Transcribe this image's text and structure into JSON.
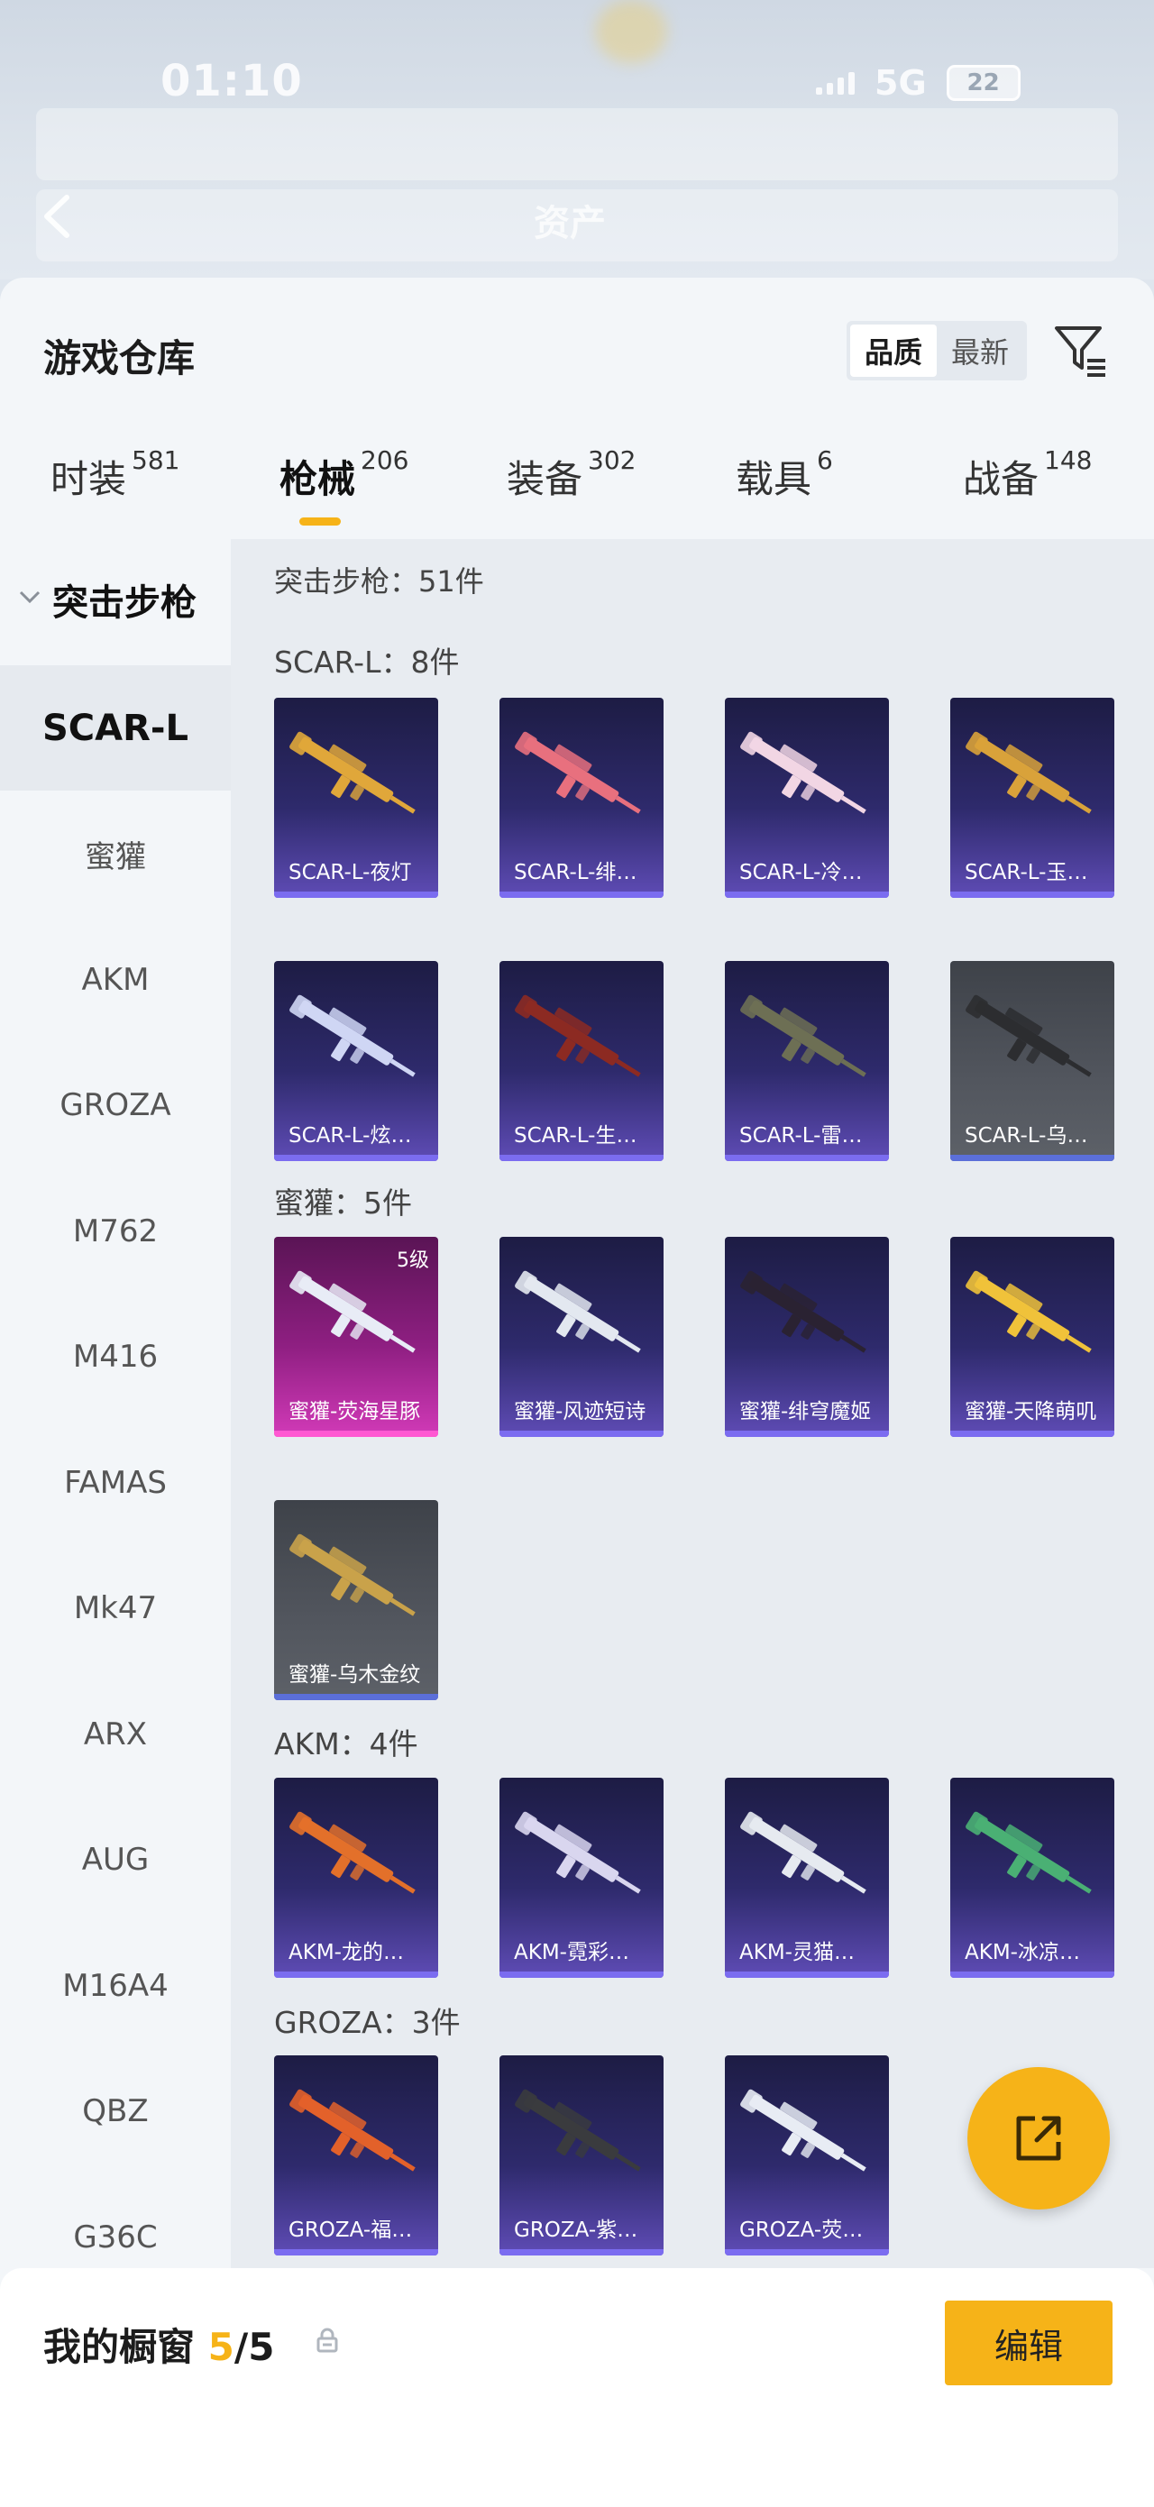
{
  "status": {
    "time": "01:10",
    "network": "5G",
    "battery": "22"
  },
  "header": {
    "title": "资产"
  },
  "panel": {
    "title": "游戏仓库",
    "sort_options": [
      "品质",
      "最新"
    ],
    "sort_selected": "品质"
  },
  "tabs": [
    {
      "label": "时装",
      "count": "581",
      "active": false
    },
    {
      "label": "枪械",
      "count": "206",
      "active": true
    },
    {
      "label": "装备",
      "count": "302",
      "active": false
    },
    {
      "label": "载具",
      "count": "6",
      "active": false
    },
    {
      "label": "战备",
      "count": "148",
      "active": false
    }
  ],
  "sidebar": {
    "category": "突击步枪",
    "items": [
      "SCAR-L",
      "蜜獾",
      "AKM",
      "GROZA",
      "M762",
      "M416",
      "FAMAS",
      "Mk47",
      "ARX",
      "AUG",
      "M16A4",
      "QBZ",
      "G36C"
    ],
    "selected": "SCAR-L"
  },
  "content": {
    "header": "突击步枪：51件",
    "groups": [
      {
        "title": "SCAR-L：8件",
        "items": [
          {
            "name": "SCAR-L-夜灯",
            "style": "purple",
            "gun": "#e0a73a"
          },
          {
            "name": "SCAR-L-绯…",
            "style": "purple",
            "gun": "#e8707e"
          },
          {
            "name": "SCAR-L-冷…",
            "style": "purple",
            "gun": "#f2d6e4"
          },
          {
            "name": "SCAR-L-玉…",
            "style": "purple",
            "gun": "#d9a23a"
          },
          {
            "name": "SCAR-L-炫…",
            "style": "purple",
            "gun": "#cfd6f4"
          },
          {
            "name": "SCAR-L-生…",
            "style": "purple",
            "gun": "#8c2a22"
          },
          {
            "name": "SCAR-L-雷…",
            "style": "purple",
            "gun": "#6d6f54"
          },
          {
            "name": "SCAR-L-乌…",
            "style": "grey",
            "gun": "#2c2d30"
          }
        ]
      },
      {
        "title": "蜜獾：5件",
        "items": [
          {
            "name": "蜜獾-荧海星豚",
            "style": "pink",
            "gun": "#e8ecf6",
            "level": "5级"
          },
          {
            "name": "蜜獾-风迹短诗",
            "style": "purple",
            "gun": "#e3e8f0"
          },
          {
            "name": "蜜獾-绯穹魔姬",
            "style": "purple",
            "gun": "#2a2232"
          },
          {
            "name": "蜜獾-天降萌叽",
            "style": "purple",
            "gun": "#f0c23a"
          },
          {
            "name": "蜜獾-乌木金纹",
            "style": "grey",
            "gun": "#c9a24a"
          }
        ]
      },
      {
        "title": "AKM：4件",
        "items": [
          {
            "name": "AKM-龙的…",
            "style": "purple",
            "gun": "#e3702a"
          },
          {
            "name": "AKM-霓彩…",
            "style": "purple",
            "gun": "#d9d6ef"
          },
          {
            "name": "AKM-灵猫…",
            "style": "purple",
            "gun": "#e6eaf0"
          },
          {
            "name": "AKM-冰凉…",
            "style": "purple",
            "gun": "#4ab074"
          }
        ]
      },
      {
        "title": "GROZA：3件",
        "items": [
          {
            "name": "GROZA-福…",
            "style": "purple",
            "gun": "#e3612a"
          },
          {
            "name": "GROZA-紫…",
            "style": "purple",
            "gun": "#3a3b3e"
          },
          {
            "name": "GROZA-荧…",
            "style": "purple",
            "gun": "#e8ecf4"
          }
        ]
      }
    ]
  },
  "bottom": {
    "title": "我的橱窗",
    "count_used": "5",
    "count_total": "/5",
    "edit_label": "编辑"
  },
  "colors": {
    "accent": "#f6b318",
    "card_purple": "#2e2a6c",
    "card_grey": "#52565e",
    "card_pink": "#8f1f82"
  },
  "icons": {
    "back": "chevron-left-icon",
    "filter": "filter-icon",
    "share": "share-icon",
    "lock": "lock-icon"
  }
}
